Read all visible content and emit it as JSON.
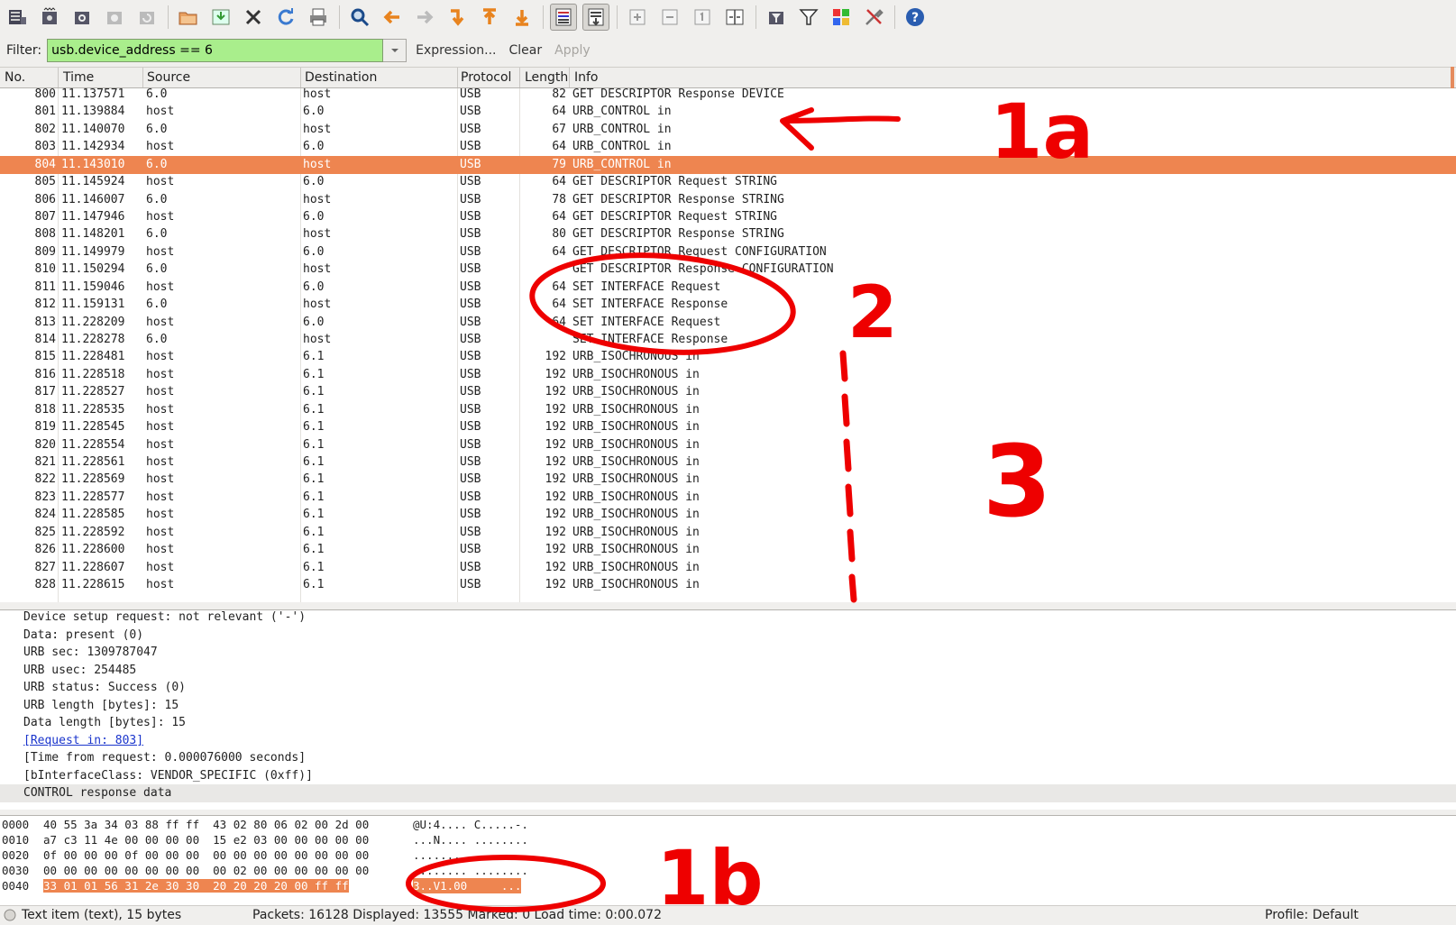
{
  "toolbar": {
    "buttons": [
      "interface-list",
      "capture-options",
      "start-capture",
      "stop-capture",
      "restart-capture",
      "open-file",
      "save-file",
      "close-file",
      "reload",
      "print",
      "find-packet",
      "go-back",
      "go-forward",
      "go-to-packet",
      "go-first",
      "go-last",
      "colorize",
      "autoscroll",
      "zoom-in",
      "zoom-out",
      "normal-size",
      "resize-columns",
      "capture-filters",
      "display-filters",
      "coloring-rules",
      "preferences",
      "help"
    ]
  },
  "filter": {
    "label": "Filter:",
    "value": "usb.device_address == 6",
    "expression_label": "Expression...",
    "clear_label": "Clear",
    "apply_label": "Apply"
  },
  "columns": [
    "No.",
    "Time",
    "Source",
    "Destination",
    "Protocol",
    "Length",
    "Info"
  ],
  "packets": [
    {
      "no": "800",
      "time": "11.137571",
      "src": "6.0",
      "dst": "host",
      "proto": "USB",
      "len": "82",
      "info": "GET DESCRIPTOR Response DEVICE"
    },
    {
      "no": "801",
      "time": "11.139884",
      "src": "host",
      "dst": "6.0",
      "proto": "USB",
      "len": "64",
      "info": "URB_CONTROL in"
    },
    {
      "no": "802",
      "time": "11.140070",
      "src": "6.0",
      "dst": "host",
      "proto": "USB",
      "len": "67",
      "info": "URB_CONTROL in"
    },
    {
      "no": "803",
      "time": "11.142934",
      "src": "host",
      "dst": "6.0",
      "proto": "USB",
      "len": "64",
      "info": "URB_CONTROL in"
    },
    {
      "no": "804",
      "time": "11.143010",
      "src": "6.0",
      "dst": "host",
      "proto": "USB",
      "len": "79",
      "info": "URB_CONTROL in",
      "selected": true
    },
    {
      "no": "805",
      "time": "11.145924",
      "src": "host",
      "dst": "6.0",
      "proto": "USB",
      "len": "64",
      "info": "GET DESCRIPTOR Request STRING"
    },
    {
      "no": "806",
      "time": "11.146007",
      "src": "6.0",
      "dst": "host",
      "proto": "USB",
      "len": "78",
      "info": "GET DESCRIPTOR Response STRING"
    },
    {
      "no": "807",
      "time": "11.147946",
      "src": "host",
      "dst": "6.0",
      "proto": "USB",
      "len": "64",
      "info": "GET DESCRIPTOR Request STRING"
    },
    {
      "no": "808",
      "time": "11.148201",
      "src": "6.0",
      "dst": "host",
      "proto": "USB",
      "len": "80",
      "info": "GET DESCRIPTOR Response STRING"
    },
    {
      "no": "809",
      "time": "11.149979",
      "src": "host",
      "dst": "6.0",
      "proto": "USB",
      "len": "64",
      "info": "GET DESCRIPTOR Request CONFIGURATION"
    },
    {
      "no": "810",
      "time": "11.150294",
      "src": "6.0",
      "dst": "host",
      "proto": "USB",
      "len": "",
      "info": "GET DESCRIPTOR Response CONFIGURATION"
    },
    {
      "no": "811",
      "time": "11.159046",
      "src": "host",
      "dst": "6.0",
      "proto": "USB",
      "len": "64",
      "info": "SET INTERFACE Request"
    },
    {
      "no": "812",
      "time": "11.159131",
      "src": "6.0",
      "dst": "host",
      "proto": "USB",
      "len": "64",
      "info": "SET INTERFACE Response"
    },
    {
      "no": "813",
      "time": "11.228209",
      "src": "host",
      "dst": "6.0",
      "proto": "USB",
      "len": "64",
      "info": "SET INTERFACE Request"
    },
    {
      "no": "814",
      "time": "11.228278",
      "src": "6.0",
      "dst": "host",
      "proto": "USB",
      "len": "",
      "info": "SET INTERFACE Response"
    },
    {
      "no": "815",
      "time": "11.228481",
      "src": "host",
      "dst": "6.1",
      "proto": "USB",
      "len": "192",
      "info": "URB_ISOCHRONOUS in"
    },
    {
      "no": "816",
      "time": "11.228518",
      "src": "host",
      "dst": "6.1",
      "proto": "USB",
      "len": "192",
      "info": "URB_ISOCHRONOUS in"
    },
    {
      "no": "817",
      "time": "11.228527",
      "src": "host",
      "dst": "6.1",
      "proto": "USB",
      "len": "192",
      "info": "URB_ISOCHRONOUS in"
    },
    {
      "no": "818",
      "time": "11.228535",
      "src": "host",
      "dst": "6.1",
      "proto": "USB",
      "len": "192",
      "info": "URB_ISOCHRONOUS in"
    },
    {
      "no": "819",
      "time": "11.228545",
      "src": "host",
      "dst": "6.1",
      "proto": "USB",
      "len": "192",
      "info": "URB_ISOCHRONOUS in"
    },
    {
      "no": "820",
      "time": "11.228554",
      "src": "host",
      "dst": "6.1",
      "proto": "USB",
      "len": "192",
      "info": "URB_ISOCHRONOUS in"
    },
    {
      "no": "821",
      "time": "11.228561",
      "src": "host",
      "dst": "6.1",
      "proto": "USB",
      "len": "192",
      "info": "URB_ISOCHRONOUS in"
    },
    {
      "no": "822",
      "time": "11.228569",
      "src": "host",
      "dst": "6.1",
      "proto": "USB",
      "len": "192",
      "info": "URB_ISOCHRONOUS in"
    },
    {
      "no": "823",
      "time": "11.228577",
      "src": "host",
      "dst": "6.1",
      "proto": "USB",
      "len": "192",
      "info": "URB_ISOCHRONOUS in"
    },
    {
      "no": "824",
      "time": "11.228585",
      "src": "host",
      "dst": "6.1",
      "proto": "USB",
      "len": "192",
      "info": "URB_ISOCHRONOUS in"
    },
    {
      "no": "825",
      "time": "11.228592",
      "src": "host",
      "dst": "6.1",
      "proto": "USB",
      "len": "192",
      "info": "URB_ISOCHRONOUS in"
    },
    {
      "no": "826",
      "time": "11.228600",
      "src": "host",
      "dst": "6.1",
      "proto": "USB",
      "len": "192",
      "info": "URB_ISOCHRONOUS in"
    },
    {
      "no": "827",
      "time": "11.228607",
      "src": "host",
      "dst": "6.1",
      "proto": "USB",
      "len": "192",
      "info": "URB_ISOCHRONOUS in"
    },
    {
      "no": "828",
      "time": "11.228615",
      "src": "host",
      "dst": "6.1",
      "proto": "USB",
      "len": "192",
      "info": "URB_ISOCHRONOUS in"
    }
  ],
  "details": [
    {
      "text": "Device setup request: not relevant ('-')"
    },
    {
      "text": "Data: present (0)"
    },
    {
      "text": "URB sec: 1309787047"
    },
    {
      "text": "URB usec: 254485"
    },
    {
      "text": "URB status: Success (0)"
    },
    {
      "text": "URB length [bytes]: 15"
    },
    {
      "text": "Data length [bytes]: 15"
    },
    {
      "text": "[Request in: 803]",
      "link": true
    },
    {
      "text": "[Time from request: 0.000076000 seconds]"
    },
    {
      "text": "[bInterfaceClass: VENDOR_SPECIFIC (0xff)]"
    },
    {
      "text": "CONTROL response data",
      "highlight": true
    }
  ],
  "bytes": [
    {
      "offset": "0000",
      "hex": "40 55 3a 34 03 88 ff ff  43 02 80 06 02 00 2d 00",
      "ascii": "@U:4.... C.....-."
    },
    {
      "offset": "0010",
      "hex": "a7 c3 11 4e 00 00 00 00  15 e2 03 00 00 00 00 00",
      "ascii": "...N.... ........"
    },
    {
      "offset": "0020",
      "hex": "0f 00 00 00 0f 00 00 00  00 00 00 00 00 00 00 00",
      "ascii": "........ ........"
    },
    {
      "offset": "0030",
      "hex": "00 00 00 00 00 00 00 00  00 02 00 00 00 00 00 00",
      "ascii": "........ ........"
    },
    {
      "offset": "0040",
      "hex": "33 01 01 56 31 2e 30 30  20 20 20 20 00 ff ff",
      "ascii": "3..V1.00     ...",
      "selected": true
    }
  ],
  "status": {
    "item": "Text item (text), 15 bytes",
    "packets": "Packets: 16128 Displayed: 13555 Marked: 0 Load time: 0:00.072",
    "profile": "Profile: Default"
  },
  "annotations": {
    "label_1a": "1a",
    "label_2": "2",
    "label_3": "3",
    "label_1b": "1b",
    "color": "#ee0000"
  },
  "colors": {
    "selected_row": "#ee8550",
    "filter_bg": "#a9ee8c"
  }
}
